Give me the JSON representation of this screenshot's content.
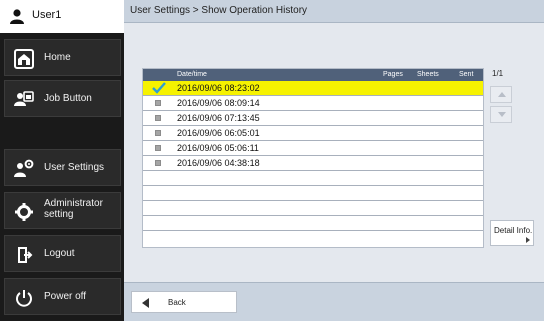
{
  "user": {
    "name": "User1",
    "icon": "user-icon"
  },
  "sidebar": {
    "items": [
      {
        "label": "Home",
        "icon": "home-icon"
      },
      {
        "label": "Job Button",
        "icon": "job-button-icon"
      },
      {
        "label": "User Settings",
        "icon": "user-settings-icon"
      },
      {
        "label": "Administrator setting",
        "icon": "admin-gear-icon"
      },
      {
        "label": "Logout",
        "icon": "logout-icon"
      },
      {
        "label": "Power off",
        "icon": "power-icon"
      }
    ]
  },
  "header": {
    "title": "User Settings > Show Operation History"
  },
  "history": {
    "columns": {
      "datetime": "Date/time",
      "pages": "Pages",
      "sheets": "Sheets",
      "sent": "Sent"
    },
    "rows": [
      {
        "datetime": "2016/09/06 08:23:02",
        "selected": true
      },
      {
        "datetime": "2016/09/06 08:09:14",
        "selected": false
      },
      {
        "datetime": "2016/09/06 07:13:45",
        "selected": false
      },
      {
        "datetime": "2016/09/06 06:05:01",
        "selected": false
      },
      {
        "datetime": "2016/09/06 05:06:11",
        "selected": false
      },
      {
        "datetime": "2016/09/06 04:38:18",
        "selected": false
      }
    ],
    "empty_rows": 4,
    "page_indicator": "1/1"
  },
  "buttons": {
    "detail_info": "Detail Info.",
    "back": "Back"
  },
  "colors": {
    "selected_row": "#f6f200",
    "header_bg": "#50617a",
    "sidebar_bg": "#1a1a1a"
  }
}
